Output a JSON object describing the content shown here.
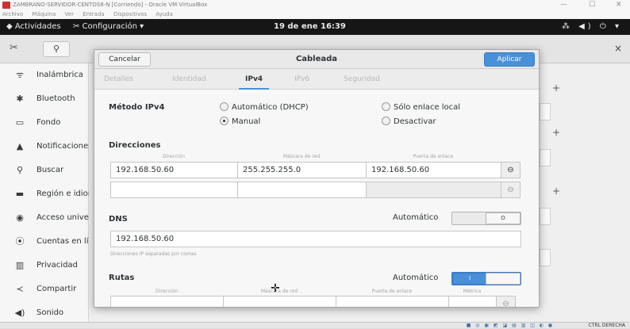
{
  "host": {
    "title": "ZAMBRANO-SERVIDOR-CENTOS8-N [Corriendo] - Oracle VM VirtualBox",
    "menu": [
      "Archivo",
      "Máquina",
      "Ver",
      "Entrada",
      "Dispositivos",
      "Ayuda"
    ],
    "minimize": "—",
    "maximize": "☐",
    "close": "✕",
    "status_icons": "■ ◎ ▣ ◩ ◪ ▤ ▥ ◫ ◐ ◼",
    "host_key": "CTRL DERECHA"
  },
  "topbar": {
    "activities": "◆ Actividades",
    "app_menu": "✂ Configuración ▾",
    "clock": "19 de ene  16:39",
    "tray": "⁂ ◀) ⏻ ▾"
  },
  "settings_header": {
    "tool_icon": "✂",
    "search_icon": "⚲",
    "close": "×"
  },
  "sidebar": {
    "items": [
      {
        "icon": "wifi-icon",
        "glyph": "ᯤ",
        "label": "Inalámbrica"
      },
      {
        "icon": "bluetooth-icon",
        "glyph": "✱",
        "label": "Bluetooth"
      },
      {
        "icon": "background-icon",
        "glyph": "▭",
        "label": "Fondo"
      },
      {
        "icon": "notifications-icon",
        "glyph": "▲",
        "label": "Notificaciones"
      },
      {
        "icon": "search-icon",
        "glyph": "⚲",
        "label": "Buscar"
      },
      {
        "icon": "region-icon",
        "glyph": "▬",
        "label": "Región e idioma"
      },
      {
        "icon": "accessibility-icon",
        "glyph": "◉",
        "label": "Acceso universal"
      },
      {
        "icon": "accounts-icon",
        "glyph": "⦿",
        "label": "Cuentas en línea"
      },
      {
        "icon": "privacy-icon",
        "glyph": "▥",
        "label": "Privacidad"
      },
      {
        "icon": "sharing-icon",
        "glyph": "≺",
        "label": "Compartir"
      },
      {
        "icon": "sound-icon",
        "glyph": "◀)",
        "label": "Sonido"
      }
    ]
  },
  "background": {
    "plus": "+"
  },
  "dialog": {
    "cancel": "Cancelar",
    "title": "Cableada",
    "apply": "Aplicar",
    "tabs": [
      "Detalles",
      "Identidad",
      "IPv4",
      "IPv6",
      "Seguridad"
    ],
    "active_tab": "IPv4",
    "method_label": "Método IPv4",
    "methods": [
      {
        "label": "Automático (DHCP)",
        "selected": false
      },
      {
        "label": "Sólo enlace local",
        "selected": false
      },
      {
        "label": "Manual",
        "selected": true
      },
      {
        "label": "Desactivar",
        "selected": false
      }
    ],
    "addresses": {
      "title": "Direcciones",
      "col_address": "Dirección",
      "col_netmask": "Máscara de red",
      "col_gateway": "Puerta de enlace",
      "rows": [
        {
          "address": "192.168.50.60",
          "netmask": "255.255.255.0",
          "gateway": "192.168.50.60"
        },
        {
          "address": "",
          "netmask": "",
          "gateway": ""
        }
      ],
      "delete_glyph": "⊖"
    },
    "dns": {
      "title": "DNS",
      "auto_label": "Automático",
      "auto_on": false,
      "switch_off_glyph": "O",
      "value": "192.168.50.60",
      "hint": "Direcciones IP separadas por comas"
    },
    "routes": {
      "title": "Rutas",
      "auto_label": "Automático",
      "auto_on": true,
      "switch_on_glyph": "I",
      "col_address": "Dirección",
      "col_netmask": "Máscara de red",
      "col_gateway": "Puerta de enlace",
      "col_metric": "Métrica"
    }
  }
}
